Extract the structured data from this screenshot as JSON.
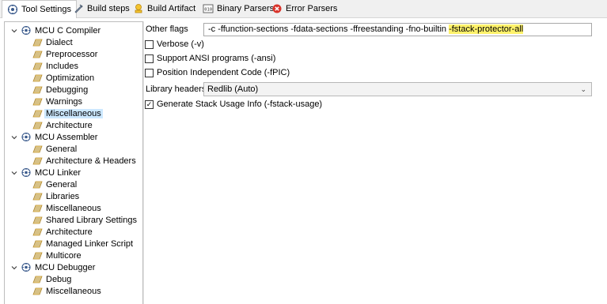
{
  "tabs": [
    {
      "label": "Tool Settings",
      "icon": "tool-settings-icon",
      "active": true
    },
    {
      "label": "Build steps",
      "icon": "build-steps-icon",
      "active": false
    },
    {
      "label": "Build Artifact",
      "icon": "build-artifact-icon",
      "active": false
    },
    {
      "label": "Binary Parsers",
      "icon": "binary-parsers-icon",
      "active": false
    },
    {
      "label": "Error Parsers",
      "icon": "error-parsers-icon",
      "active": false
    }
  ],
  "tree": {
    "groups": [
      {
        "label": "MCU C Compiler",
        "expanded": true,
        "children": [
          "Dialect",
          "Preprocessor",
          "Includes",
          "Optimization",
          "Debugging",
          "Warnings",
          "Miscellaneous",
          "Architecture"
        ]
      },
      {
        "label": "MCU Assembler",
        "expanded": true,
        "children": [
          "General",
          "Architecture & Headers"
        ]
      },
      {
        "label": "MCU Linker",
        "expanded": true,
        "children": [
          "General",
          "Libraries",
          "Miscellaneous",
          "Shared Library Settings",
          "Architecture",
          "Managed Linker Script",
          "Multicore"
        ]
      },
      {
        "label": "MCU Debugger",
        "expanded": true,
        "children": [
          "Debug",
          "Miscellaneous"
        ]
      }
    ],
    "selected": "MCU C Compiler / Miscellaneous"
  },
  "settings": {
    "other_flags_label": "Other flags",
    "other_flags_value_plain": "-c -ffunction-sections -fdata-sections -ffreestanding -fno-builtin ",
    "other_flags_value_highlighted": "-fstack-protector-all",
    "highlight_color": "#fff26b",
    "verbose_label": "Verbose (-v)",
    "verbose_checked": false,
    "ansi_label": "Support ANSI programs (-ansi)",
    "ansi_checked": false,
    "pic_label": "Position Independent Code (-fPIC)",
    "pic_checked": false,
    "library_headers_label": "Library headers",
    "library_headers_value": "Redlib (Auto)",
    "stack_usage_label": "Generate Stack Usage Info (-fstack-usage)",
    "stack_usage_checked": true
  },
  "colors": {
    "selection": "#cce8ff",
    "tabbar_bg": "#f0f0f0",
    "error_icon": "#d9342b"
  }
}
